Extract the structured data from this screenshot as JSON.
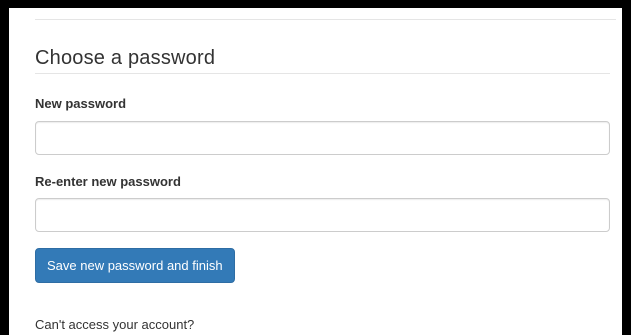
{
  "form": {
    "heading": "Choose a password",
    "new_password": {
      "label": "New password",
      "value": "",
      "placeholder": ""
    },
    "reenter_password": {
      "label": "Re-enter new password",
      "value": "",
      "placeholder": ""
    },
    "submit_label": "Save new password and finish",
    "help_link": "Can't access your account?"
  },
  "colors": {
    "primary_button": "#337ab7",
    "text": "#333333",
    "input_border": "#cccccc"
  }
}
